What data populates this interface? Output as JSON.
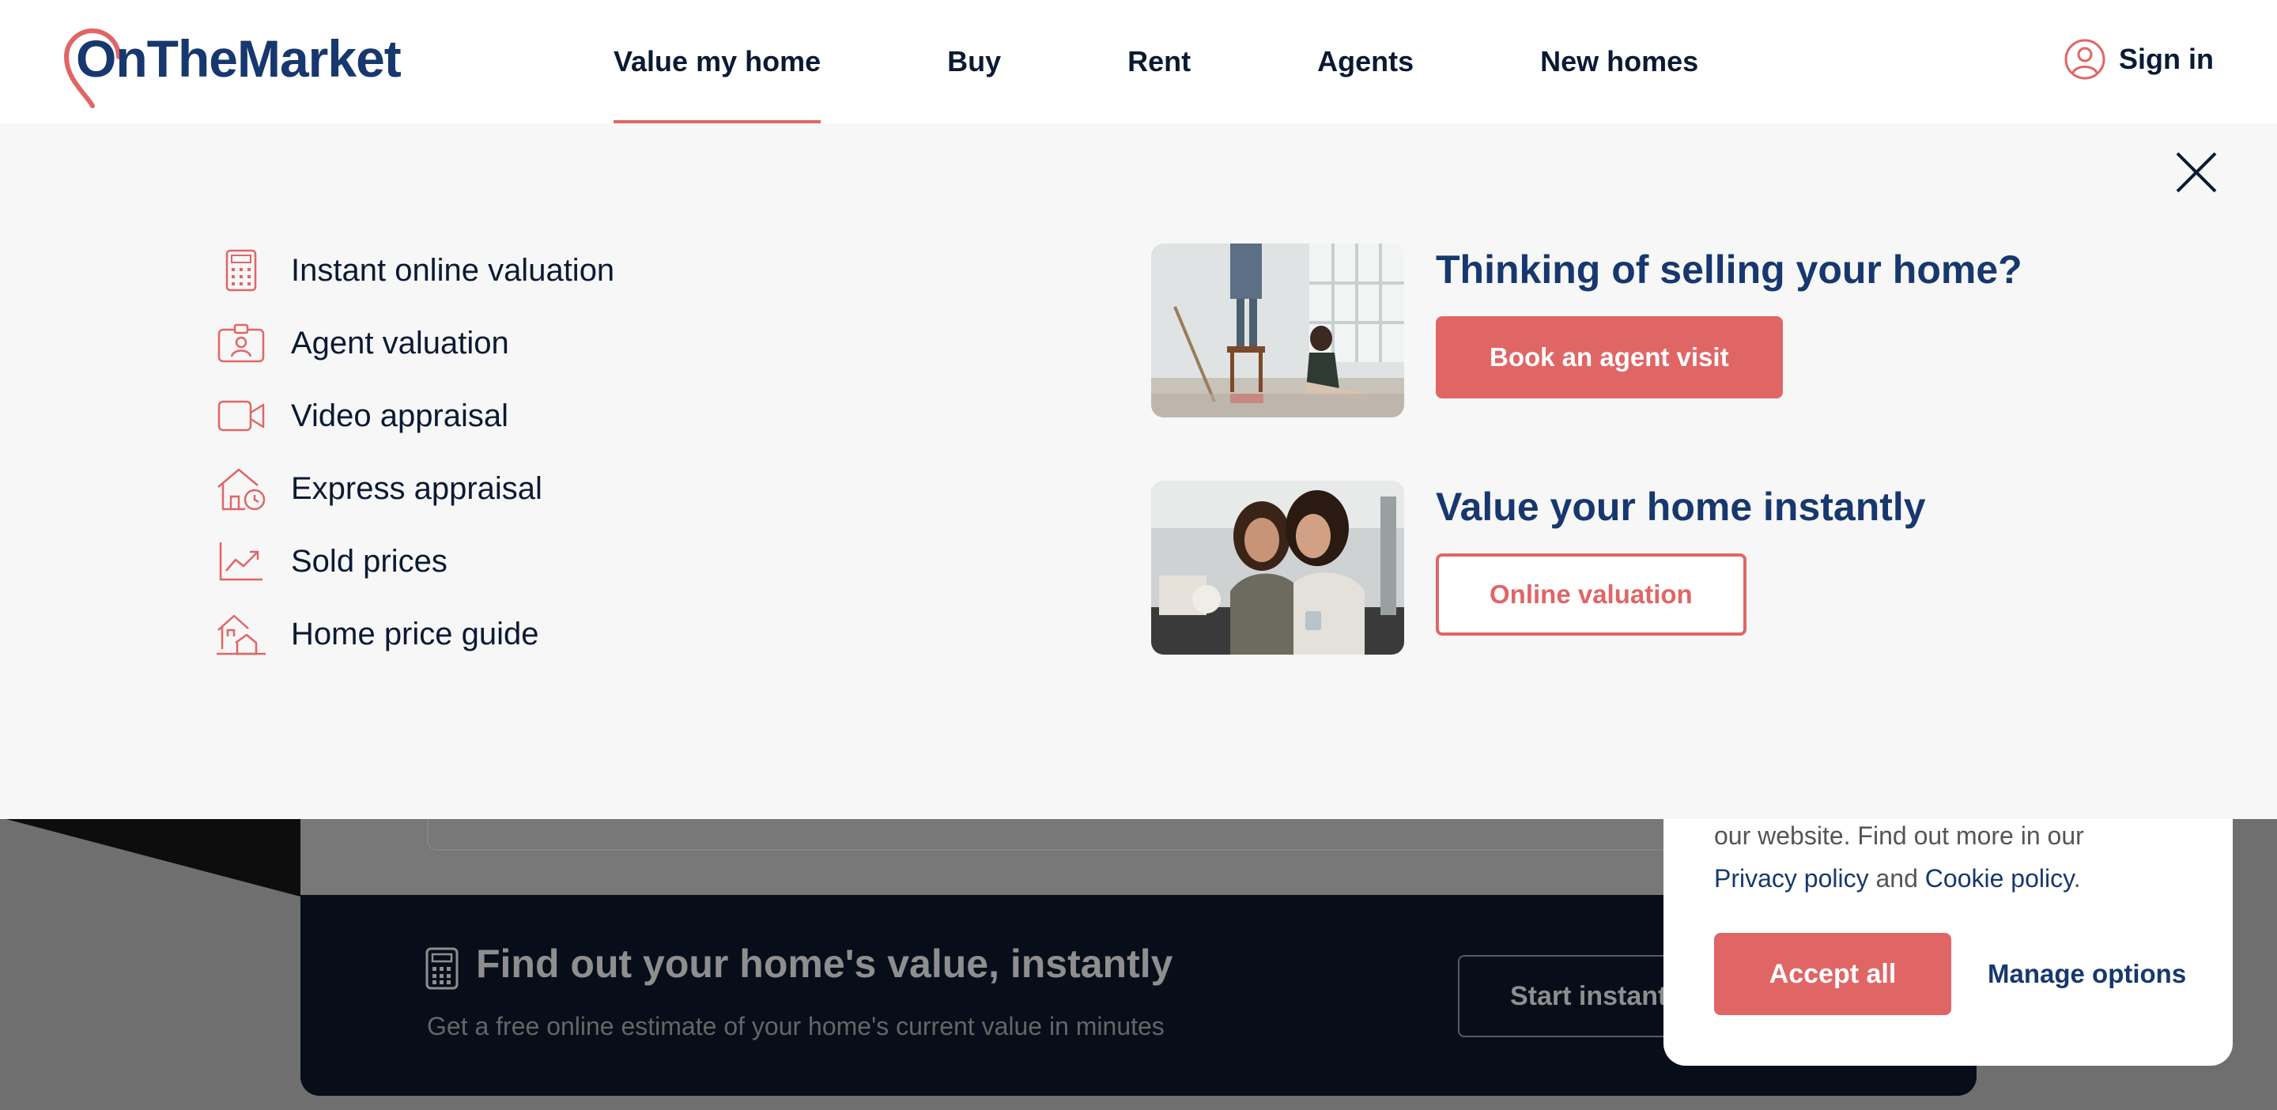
{
  "header": {
    "logo_text": "OnTheMarket",
    "nav": [
      {
        "label": "Value my home",
        "active": true
      },
      {
        "label": "Buy"
      },
      {
        "label": "Rent"
      },
      {
        "label": "Agents"
      },
      {
        "label": "New homes"
      }
    ],
    "sign_in": "Sign in"
  },
  "mega_menu": {
    "items": [
      {
        "label": "Instant online valuation",
        "icon": "calculator-icon"
      },
      {
        "label": "Agent valuation",
        "icon": "id-badge-icon"
      },
      {
        "label": "Video appraisal",
        "icon": "video-camera-icon"
      },
      {
        "label": "Express appraisal",
        "icon": "house-clock-icon"
      },
      {
        "label": "Sold prices",
        "icon": "trend-chart-icon"
      },
      {
        "label": "Home price guide",
        "icon": "houses-icon"
      }
    ],
    "promos": [
      {
        "title": "Thinking of selling your home?",
        "button": "Book an agent visit"
      },
      {
        "title": "Value your home instantly",
        "button": "Online valuation"
      }
    ]
  },
  "background": {
    "cta_title": "Find out your home's value, instantly",
    "cta_subtitle": "Get a free online estimate of your home's current value in minutes",
    "cta_button": "Start instant"
  },
  "cookie": {
    "text_line1": "our website. Find out more in our",
    "privacy_link": "Privacy policy",
    "and_text": "and",
    "cookie_link": "Cookie policy",
    "period": ".",
    "accept": "Accept all",
    "manage": "Manage options"
  },
  "colors": {
    "brand_navy": "#17386e",
    "brand_coral": "#e06666",
    "menu_bg": "#f7f7f7"
  }
}
